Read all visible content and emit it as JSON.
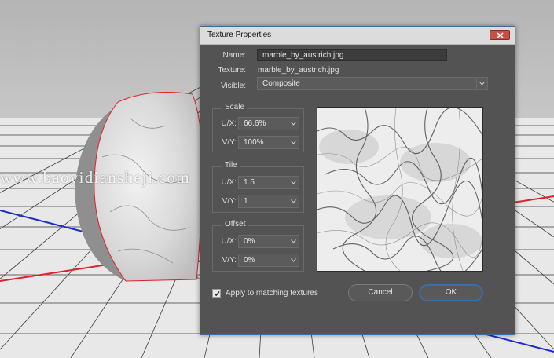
{
  "watermark": "www.baoyidiansheji.com",
  "dialog": {
    "title": "Texture Properties",
    "name_label": "Name:",
    "name_value": "marble_by_austrich.jpg",
    "texture_label": "Texture:",
    "texture_value": "marble_by_austrich.jpg",
    "visible_label": "Visible:",
    "visible_value": "Composite",
    "scale": {
      "title": "Scale",
      "ux_label": "U/X:",
      "ux_value": "66.6%",
      "vy_label": "V/Y:",
      "vy_value": "100%"
    },
    "tile": {
      "title": "Tile",
      "ux_label": "U/X:",
      "ux_value": "1.5",
      "vy_label": "V/Y:",
      "vy_value": "1"
    },
    "offset": {
      "title": "Offset",
      "ux_label": "U/X:",
      "ux_value": "0%",
      "vy_label": "V/Y:",
      "vy_value": "0%"
    },
    "apply_label": "Apply to matching textures",
    "apply_checked": true,
    "cancel_label": "Cancel",
    "ok_label": "OK"
  },
  "colors": {
    "dialog_bg": "#535353",
    "ok_border": "#3a6ea8",
    "axis_red": "#e0202a",
    "axis_blue": "#1a2ad0"
  },
  "icons": {
    "close": "close-icon",
    "dropdown": "chevron-down-icon",
    "check": "checkmark-icon"
  }
}
